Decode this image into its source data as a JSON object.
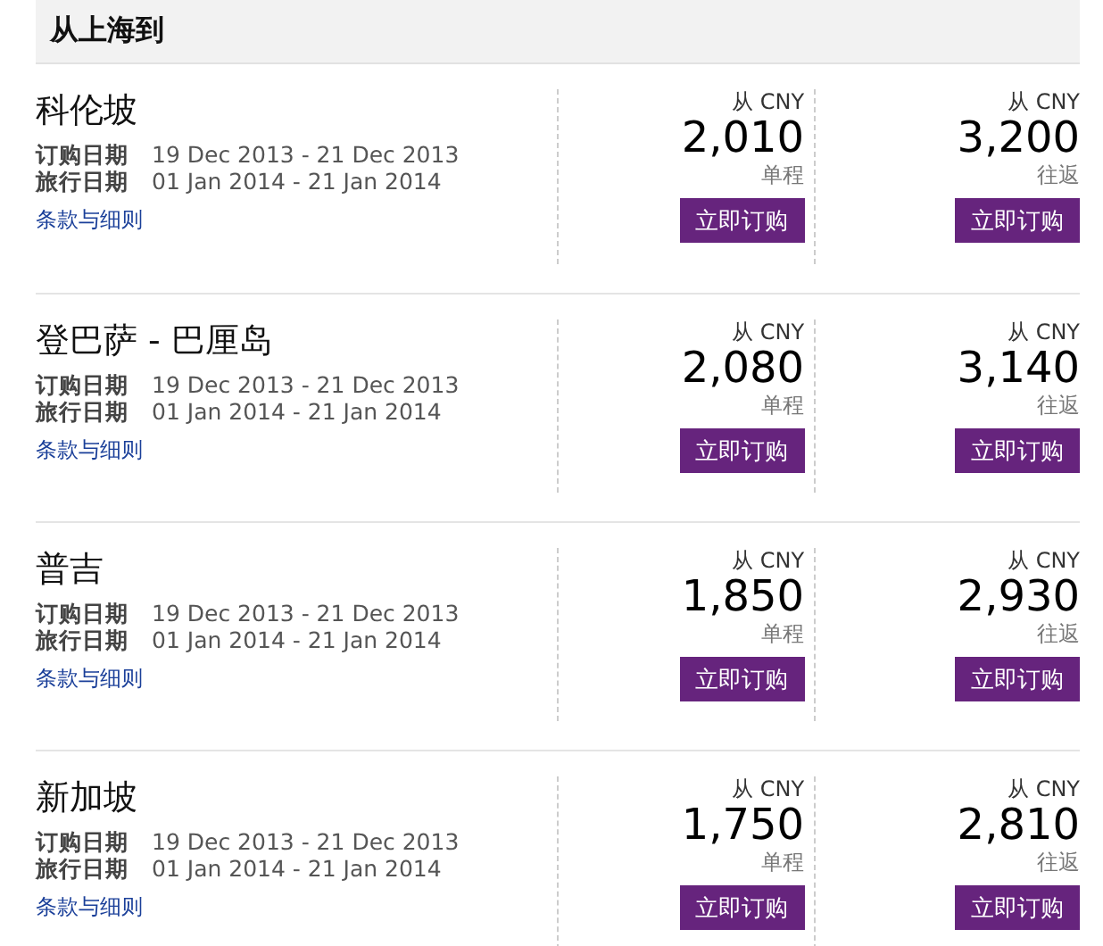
{
  "header": {
    "title": "从上海到"
  },
  "destinations": [
    {
      "city": "科伦坡",
      "purchase_label": "订购日期",
      "purchase_dates": "19 Dec 2013 - 21 Dec 2013",
      "travel_label": "旅行日期",
      "travel_dates": "01 Jan 2014 - 21 Jan 2014",
      "terms": "条款与细则",
      "fares": [
        {
          "from": "从 CNY",
          "price": "2,010",
          "type": "单程",
          "button": "立即订购"
        },
        {
          "from": "从 CNY",
          "price": "3,200",
          "type": "往返",
          "button": "立即订购"
        }
      ]
    },
    {
      "city": "登巴萨 - 巴厘岛",
      "purchase_label": "订购日期",
      "purchase_dates": "19 Dec 2013 - 21 Dec 2013",
      "travel_label": "旅行日期",
      "travel_dates": "01 Jan 2014 - 21 Jan 2014",
      "terms": "条款与细则",
      "fares": [
        {
          "from": "从 CNY",
          "price": "2,080",
          "type": "单程",
          "button": "立即订购"
        },
        {
          "from": "从 CNY",
          "price": "3,140",
          "type": "往返",
          "button": "立即订购"
        }
      ]
    },
    {
      "city": "普吉",
      "purchase_label": "订购日期",
      "purchase_dates": "19 Dec 2013 - 21 Dec 2013",
      "travel_label": "旅行日期",
      "travel_dates": "01 Jan 2014 - 21 Jan 2014",
      "terms": "条款与细则",
      "fares": [
        {
          "from": "从 CNY",
          "price": "1,850",
          "type": "单程",
          "button": "立即订购"
        },
        {
          "from": "从 CNY",
          "price": "2,930",
          "type": "往返",
          "button": "立即订购"
        }
      ]
    },
    {
      "city": "新加坡",
      "purchase_label": "订购日期",
      "purchase_dates": "19 Dec 2013 - 21 Dec 2013",
      "travel_label": "旅行日期",
      "travel_dates": "01 Jan 2014 - 21 Jan 2014",
      "terms": "条款与细则",
      "fares": [
        {
          "from": "从 CNY",
          "price": "1,750",
          "type": "单程",
          "button": "立即订购"
        },
        {
          "from": "从 CNY",
          "price": "2,810",
          "type": "往返",
          "button": "立即订购"
        }
      ]
    }
  ]
}
